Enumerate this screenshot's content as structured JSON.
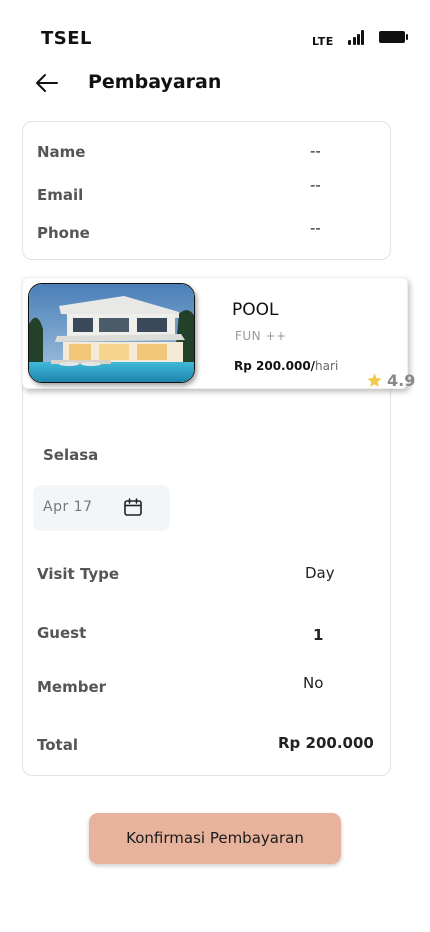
{
  "status": {
    "carrier": "TSEL",
    "network": "LTE"
  },
  "header": {
    "title": "Pembayaran"
  },
  "contact": {
    "name_label": "Name",
    "name_value": "--",
    "email_label": "Email",
    "email_value": "--",
    "phone_label": "Phone",
    "phone_value": "--"
  },
  "venue": {
    "name": "POOL",
    "subtitle": "FUN ++",
    "price": "Rp 200.000/",
    "price_unit": "hari",
    "rating": "4.9"
  },
  "booking": {
    "day": "Selasa",
    "date": "Apr  17",
    "visit_type_label": "Visit Type",
    "visit_type_value": "Day",
    "guest_label": "Guest",
    "guest_value": "1",
    "member_label": "Member",
    "member_value": "No",
    "total_label": "Total",
    "total_value": "Rp 200.000"
  },
  "actions": {
    "confirm_label": "Konfirmasi Pembayaran"
  },
  "colors": {
    "confirm_button": "#e8b39d",
    "star": "#f2c94c",
    "date_box": "#f2f6f8"
  }
}
